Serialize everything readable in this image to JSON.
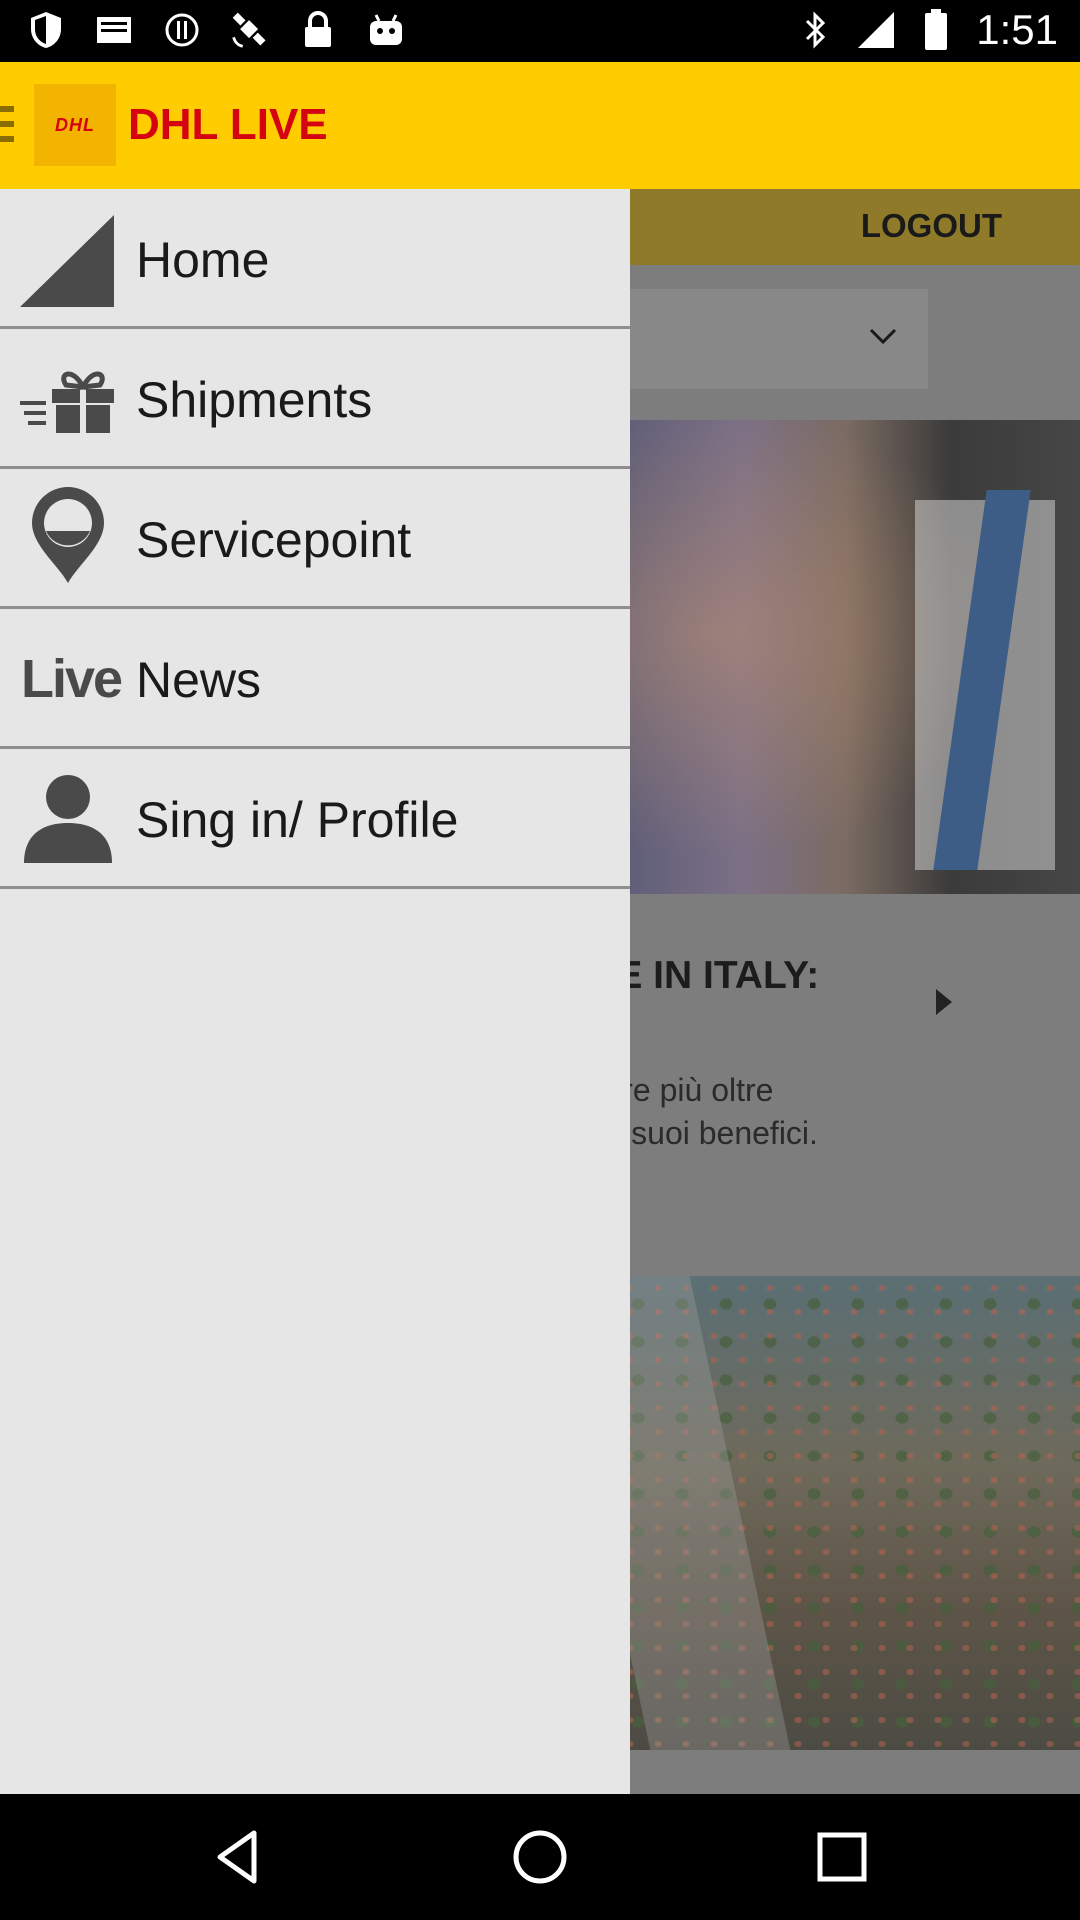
{
  "status_bar": {
    "time": "1:51",
    "icons": [
      "shield-icon",
      "mail-icon",
      "alert-circle-icon",
      "satellite-icon",
      "lock-icon",
      "android-icon",
      "bluetooth-icon",
      "signal-icon",
      "battery-icon"
    ]
  },
  "header": {
    "logo_text": "DHL",
    "title": "DHL LIVE",
    "colors": {
      "background": "#ffcc00",
      "title": "#d40511"
    }
  },
  "background": {
    "logout_label": "LOGOUT",
    "article_title": "ADE IN ITALY:",
    "article_body_line1": "empre più oltre",
    "article_body_line2": "rne i suoi benefici."
  },
  "drawer": {
    "items": [
      {
        "label": "Home",
        "icon": "home-triangle-icon"
      },
      {
        "label": "Shipments",
        "icon": "gift-list-icon"
      },
      {
        "label": "Servicepoint",
        "icon": "location-pin-icon"
      },
      {
        "label": "News",
        "icon": "live-icon",
        "icon_text": "Live"
      },
      {
        "label": "Sing in/ Profile",
        "icon": "person-icon"
      }
    ]
  },
  "nav_bar": {
    "buttons": [
      "back-icon",
      "home-icon",
      "recents-icon"
    ]
  }
}
